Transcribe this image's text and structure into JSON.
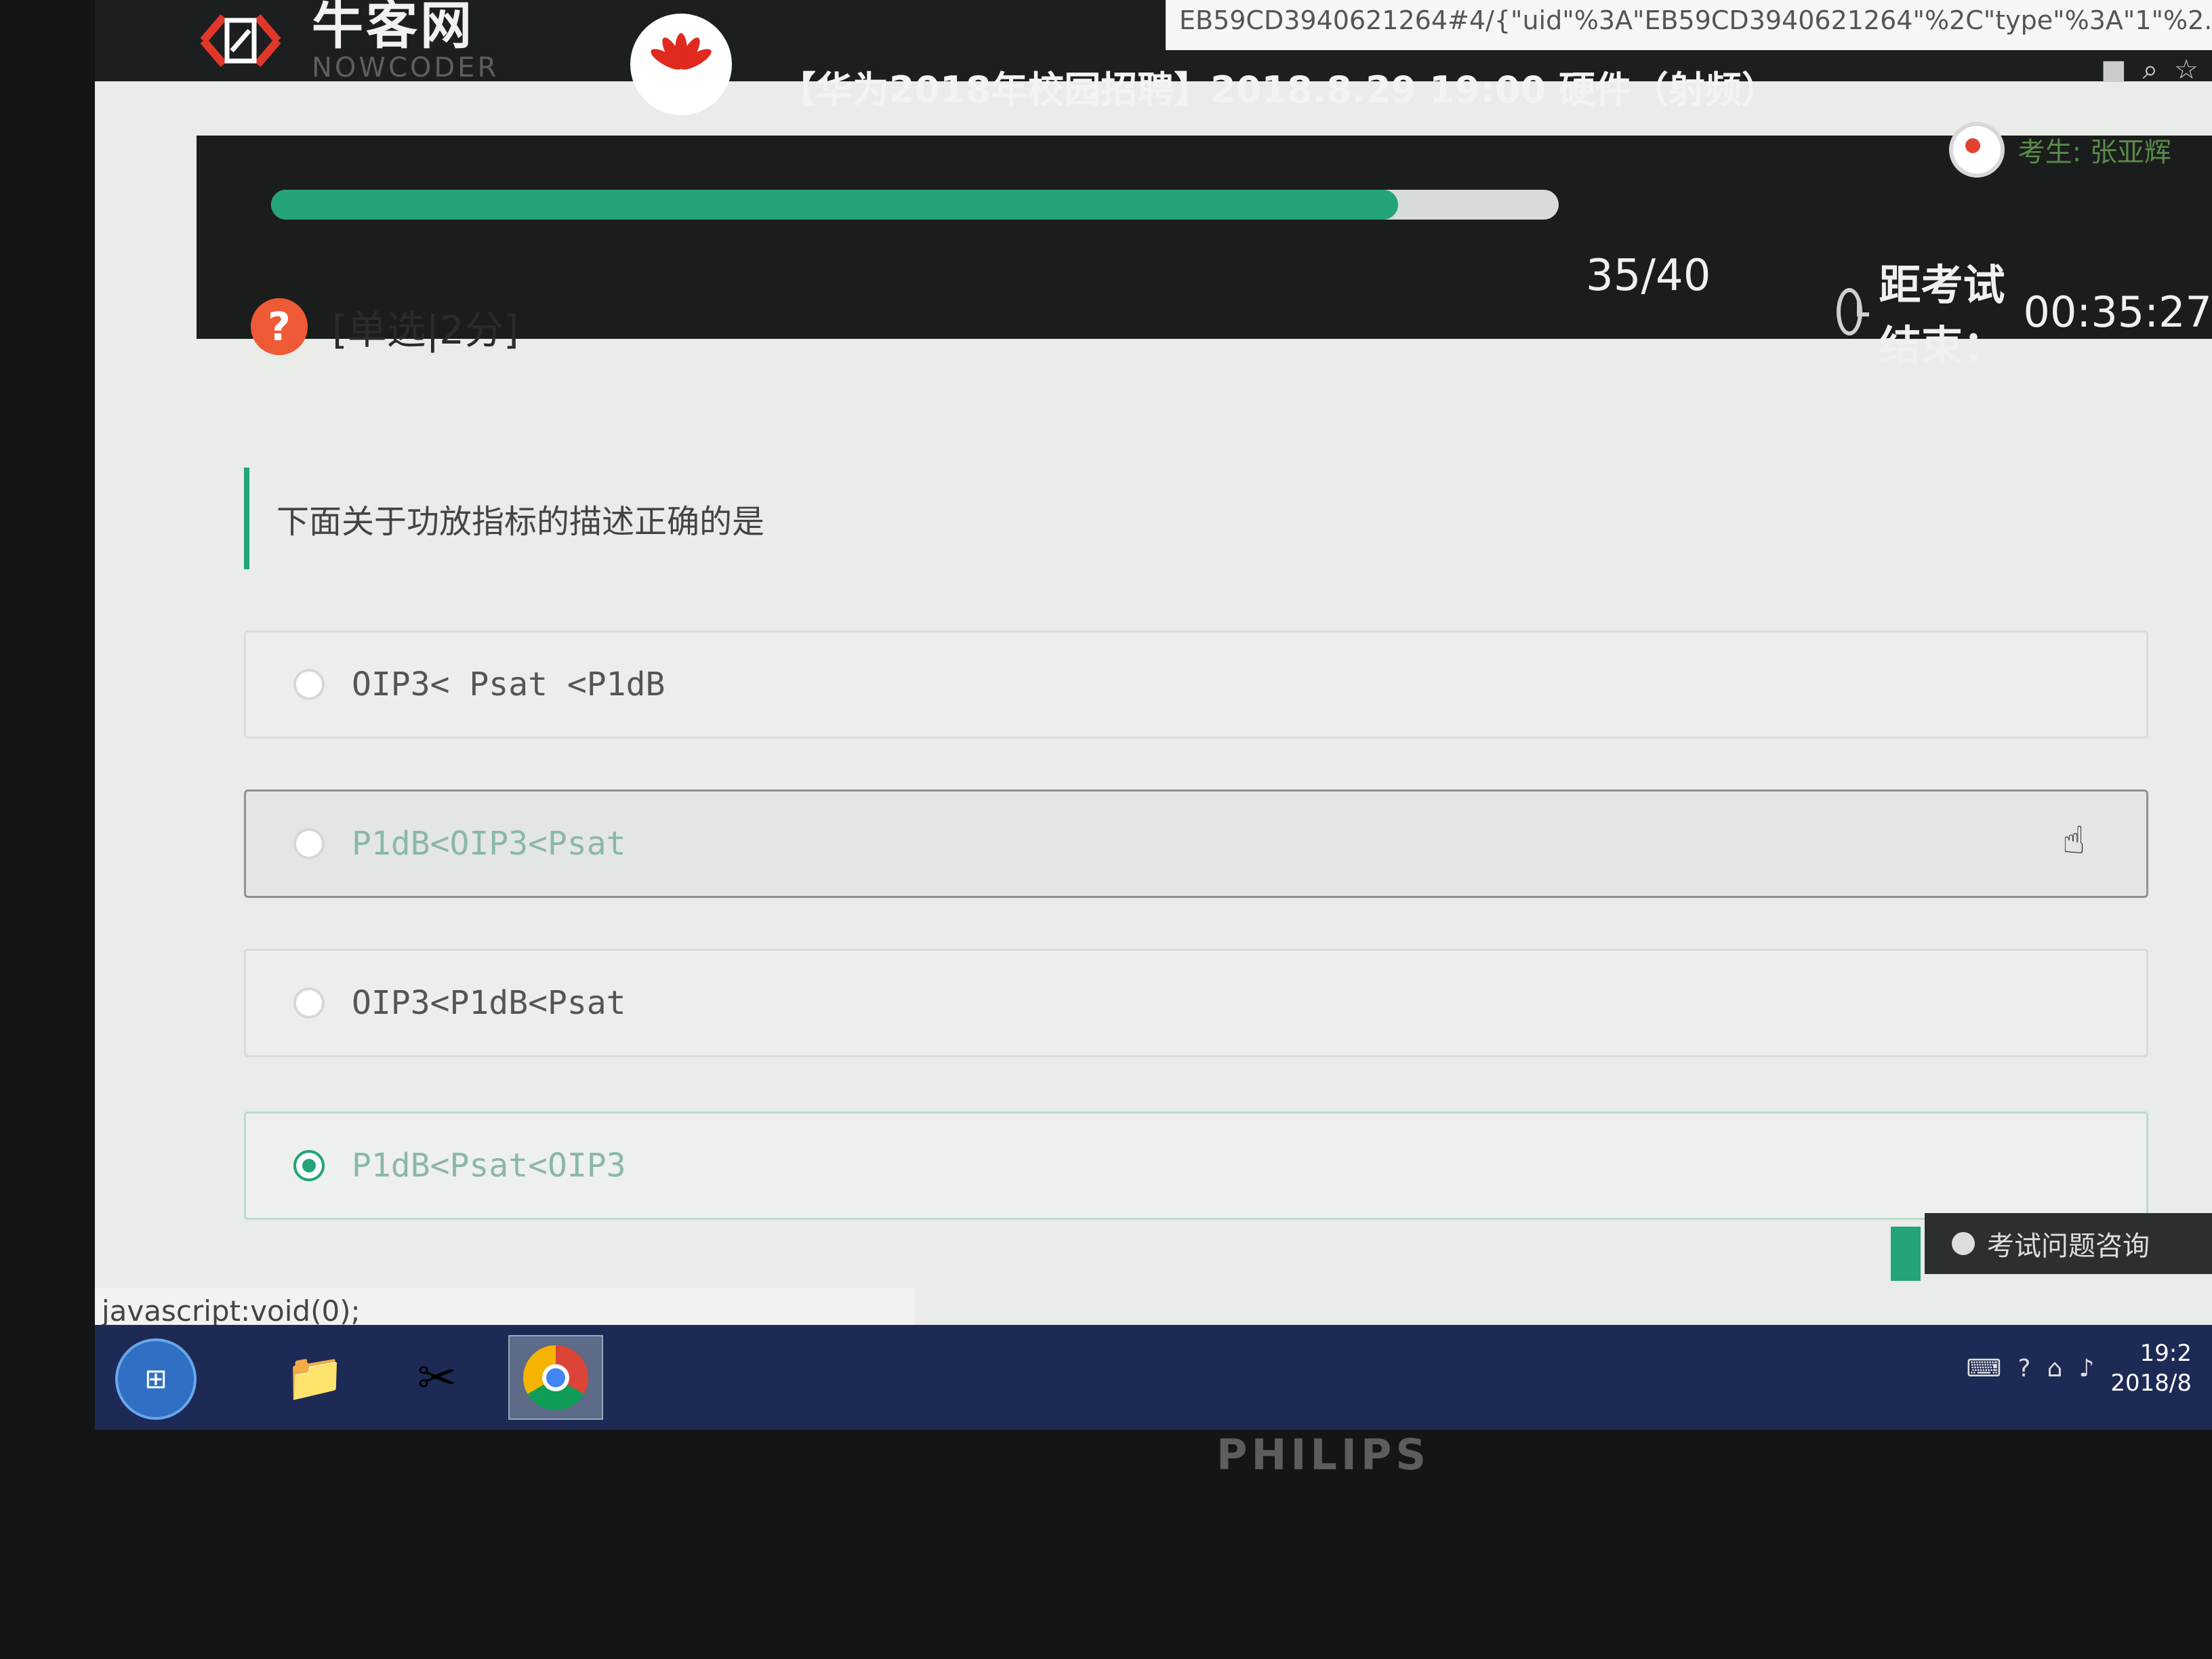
{
  "site": {
    "logo_cn": "牛客网",
    "logo_en": "NOWCODER",
    "exam_title": "【华为2018年校园招聘】2018.8.29 19:00 硬件（射频）",
    "url_fragment": "EB59CD3940621264#4/{\"uid\"%3A\"EB59CD3940621264\"%2C\"type\"%3A\"1\"%2...",
    "candidate_label": "考生: 张亚辉"
  },
  "progress": {
    "count": "35/40",
    "fraction": 0.875,
    "timer_label": "距考试结束：",
    "timer_value": "00:35:27"
  },
  "question": {
    "type_label": "[单选|2分]",
    "text": "下面关于功放指标的描述正确的是",
    "options": [
      {
        "text": "OIP3< Psat <P1dB",
        "selected": false
      },
      {
        "text": "P1dB<OIP3<Psat",
        "selected": false
      },
      {
        "text": "OIP3<P1dB<Psat",
        "selected": false
      },
      {
        "text": "P1dB<Psat<OIP3",
        "selected": true
      }
    ]
  },
  "consult": {
    "label": "考试问题咨询"
  },
  "status_bar": {
    "text": "javascript:void(0);"
  },
  "taskbar": {
    "clock_time": "19:2",
    "clock_date": "2018/8"
  },
  "monitor": {
    "brand": "PHILIPS"
  },
  "colors": {
    "accent": "#23a47a",
    "help": "#ee5a35",
    "nav": "#1c1f1f"
  }
}
